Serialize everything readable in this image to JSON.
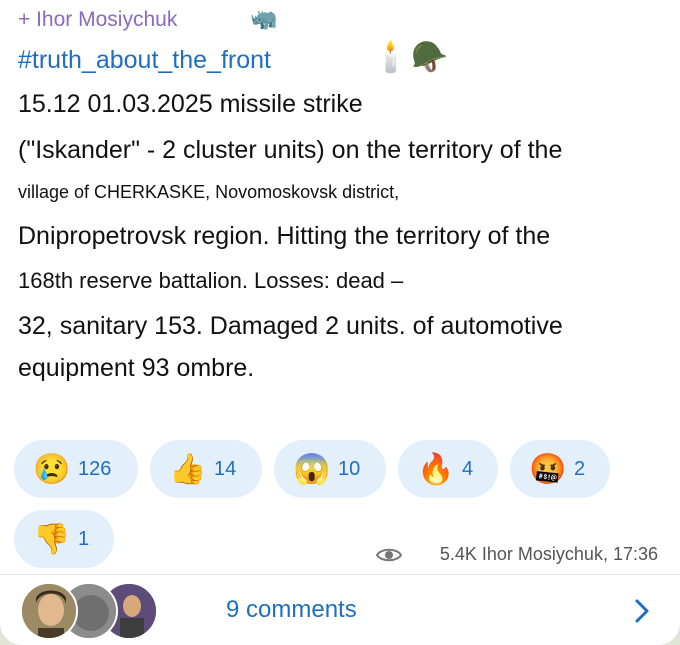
{
  "post": {
    "forward_label": "+ Ihor Mosiychuk",
    "forward_emoji": "🦏",
    "hashtag": "#truth_about_the_front",
    "hashtag_emoji": "🕯️🪖",
    "lines": [
      "15.12 01.03.2025 missile strike",
      "(\"Iskander\" - 2 cluster units) on the territory of the",
      "village of CHERKASKE, Novomoskovsk district,",
      "Dnipropetrovsk region. Hitting the territory of the",
      "168th reserve battalion. Losses: dead –",
      "32, sanitary 153. Damaged 2 units. of automotive",
      "equipment 93 ombre."
    ]
  },
  "reactions": [
    {
      "emoji": "😢",
      "count": "126"
    },
    {
      "emoji": "👍",
      "count": "14"
    },
    {
      "emoji": "😱",
      "count": "10"
    },
    {
      "emoji": "🔥",
      "count": "4"
    },
    {
      "emoji": "🤬",
      "count": "2"
    },
    {
      "emoji": "👎",
      "count": "1"
    }
  ],
  "meta": {
    "eye_icon": "eye-icon",
    "text": "5.4K Ihor Mosiychuk, 17:36"
  },
  "footer": {
    "comments_label": "9 comments",
    "chevron_icon": "chevron-right-icon"
  },
  "colors": {
    "accent": "#1e6fc2",
    "forward": "#8a6bbd",
    "reaction_bg": "#e3effa"
  }
}
